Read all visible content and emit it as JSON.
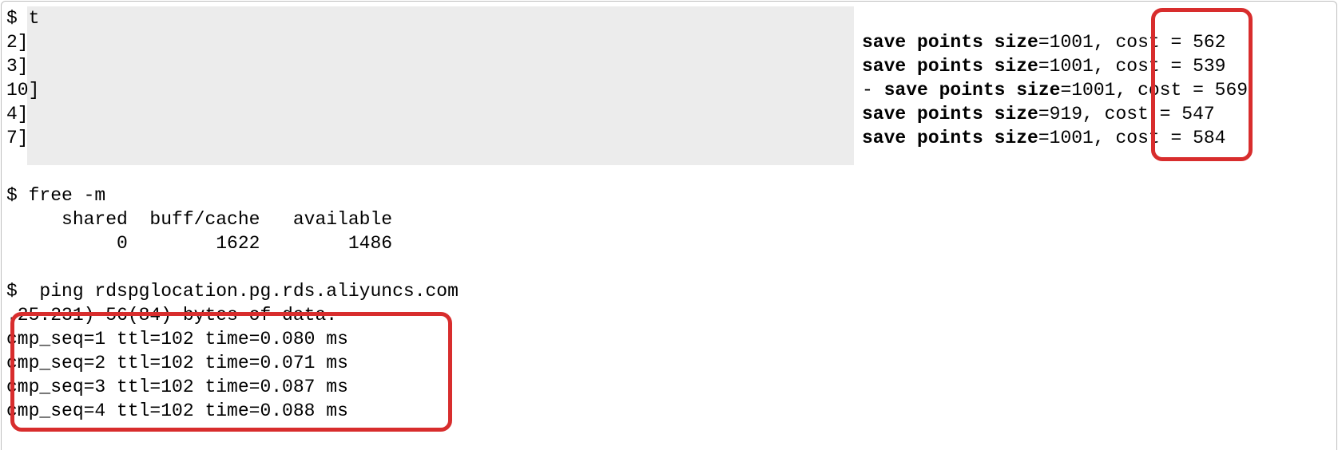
{
  "topFragments": {
    "t": "t",
    "r2": "2]",
    "r3": "3]",
    "r4": "10]",
    "r5": "4]",
    "r6": "7]"
  },
  "saveLines": [
    {
      "bold": "save points size",
      "rest": "=1001, cost = 562"
    },
    {
      "bold": "save points size",
      "rest": "=1001, cost = 539"
    },
    {
      "bold": "save points size",
      "rest": "=1001, cost = 569",
      "dashPrefix": "- "
    },
    {
      "bold": "save points size",
      "rest": "=919, cost = 547"
    },
    {
      "bold": "save points size",
      "rest": "=1001, cost = 584"
    }
  ],
  "freeCmd": "free -m",
  "freeHeader": "     shared  buff/cache   available",
  "freeValues": "          0        1622        1486",
  "pingCmd": "ping rdspglocation.pg.rds.aliyuncs.com",
  "pingHeader": ".25.231) 56(84) bytes of data.",
  "pingRows": [
    "cmp_seq=1 ttl=102 time=0.080 ms",
    "cmp_seq=2 ttl=102 time=0.071 ms",
    "cmp_seq=3 ttl=102 time=0.087 ms",
    "cmp_seq=4 ttl=102 time=0.088 ms"
  ],
  "dollarPrefix": "$ "
}
